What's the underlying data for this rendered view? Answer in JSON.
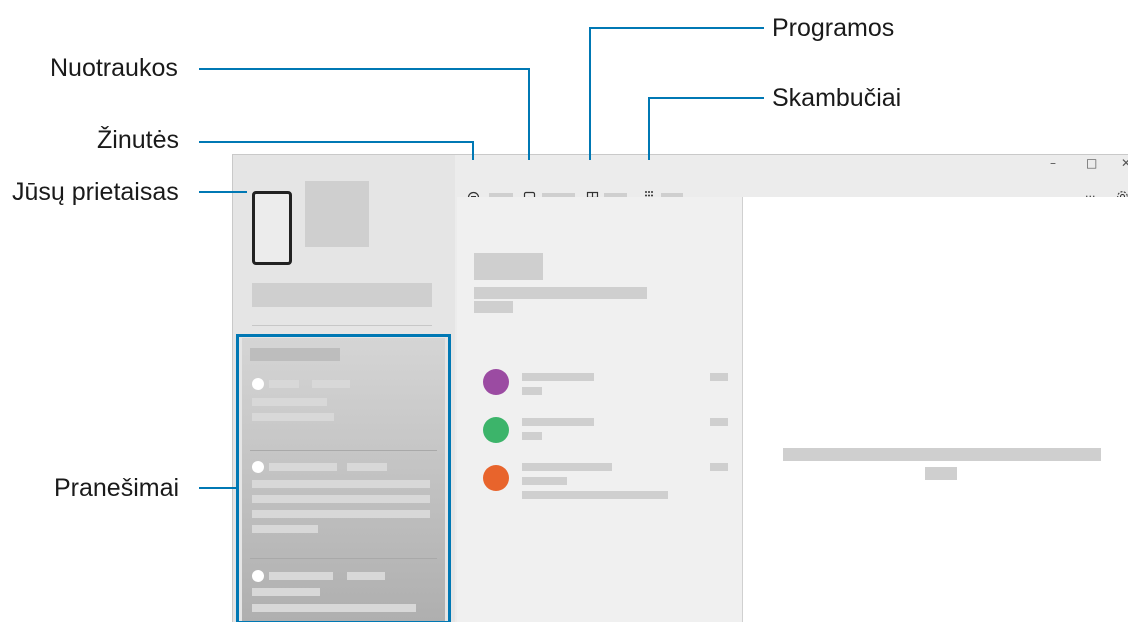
{
  "callouts": {
    "programos": "Programos",
    "nuotraukos": "Nuotraukos",
    "skambuciai": "Skambučiai",
    "zinutes": "Žinutės",
    "prietaisas": "Jūsų prietaisas",
    "pranesimai": "Pranešimai"
  },
  "window": {
    "controls": {
      "minimize": "–",
      "maximize": "□",
      "close": "✕"
    },
    "more": "···",
    "tabs": [
      {
        "name": "messages",
        "icon": "message-bubble-icon",
        "selected": true
      },
      {
        "name": "photos",
        "icon": "photo-icon",
        "selected": false
      },
      {
        "name": "apps",
        "icon": "apps-grid-icon",
        "selected": false
      },
      {
        "name": "calls",
        "icon": "dialpad-icon",
        "selected": false
      }
    ]
  },
  "conversations": [
    {
      "avatar_color": "#9b4ba2"
    },
    {
      "avatar_color": "#3cb46a"
    },
    {
      "avatar_color": "#e8642c"
    }
  ],
  "colors": {
    "accent": "#0078b4"
  }
}
